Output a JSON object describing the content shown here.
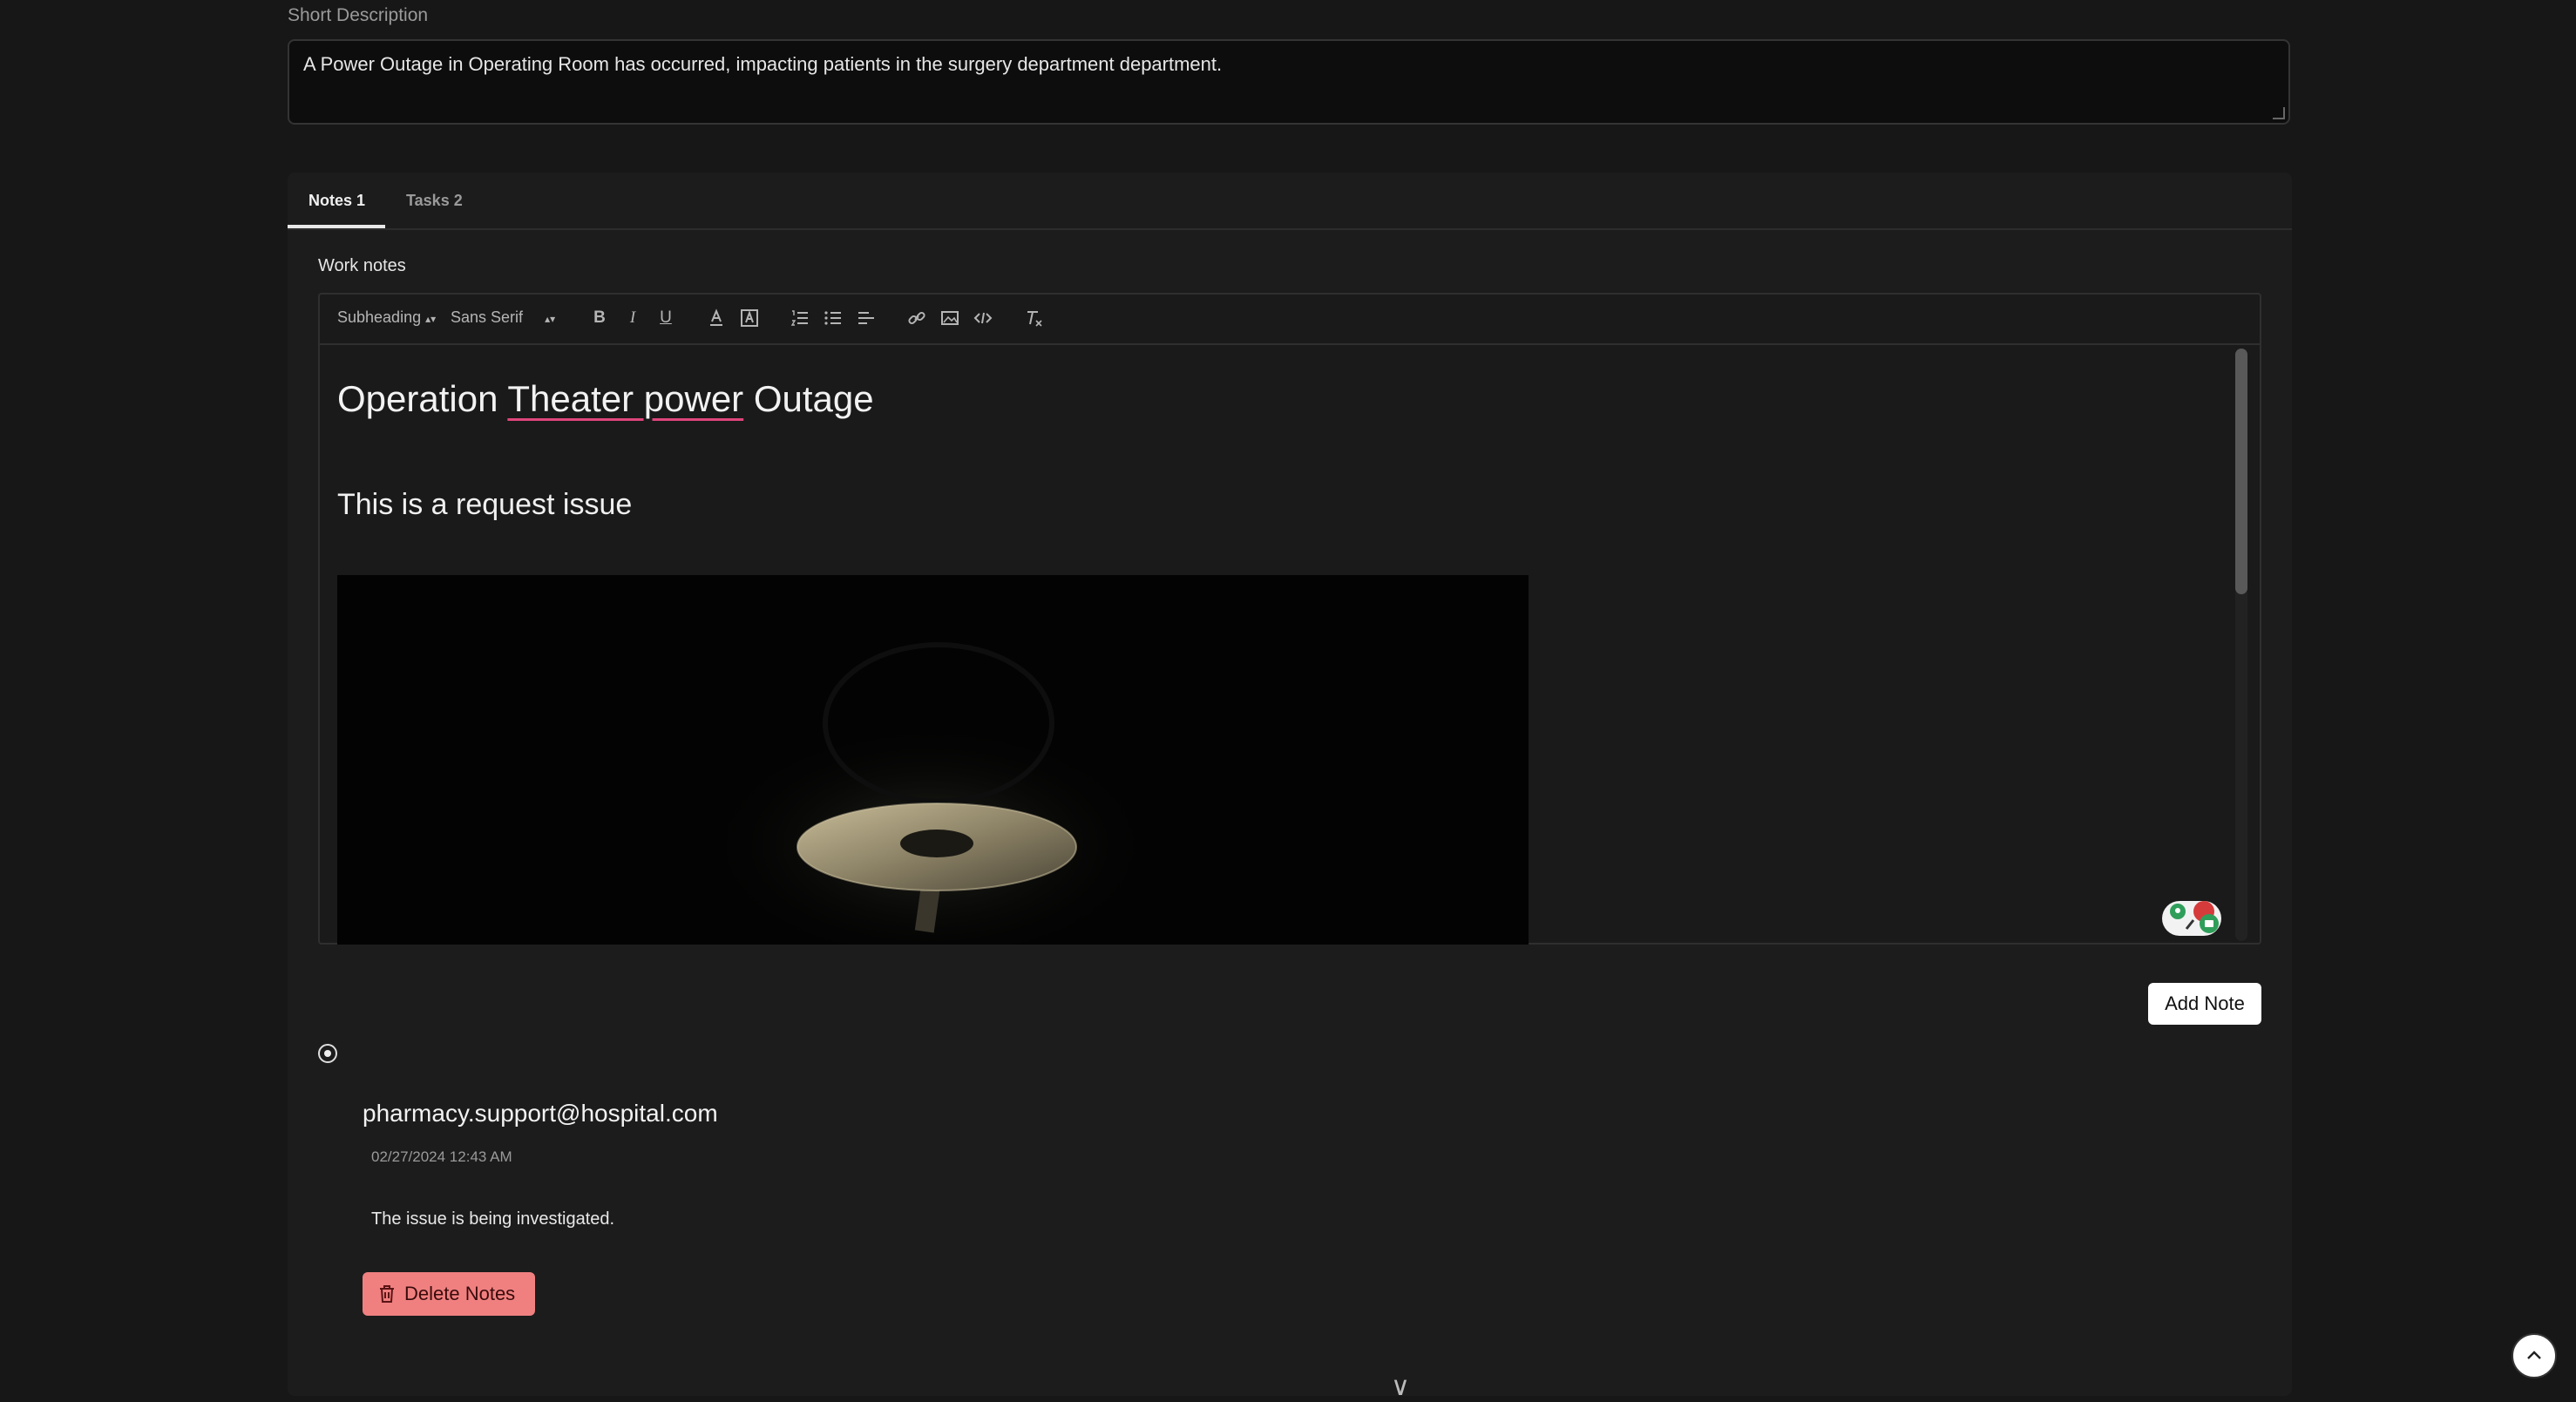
{
  "short_description": {
    "label": "Short Description",
    "value": "A Power Outage in Operating Room has occurred, impacting patients in the surgery department department."
  },
  "tabs": [
    {
      "label": "Notes 1",
      "active": true
    },
    {
      "label": "Tasks 2",
      "active": false
    }
  ],
  "work_notes": {
    "label": "Work notes",
    "toolbar": {
      "heading_select": "Subheading",
      "font_select": "Sans Serif",
      "icons": [
        "bold-icon",
        "italic-icon",
        "underline-icon",
        "text-color-icon",
        "background-color-icon",
        "ordered-list-icon",
        "bullet-list-icon",
        "align-icon",
        "link-icon",
        "image-icon",
        "code-icon",
        "clear-format-icon"
      ]
    },
    "content": {
      "heading_pre": "Operation ",
      "heading_spell": "Theater power",
      "heading_post": " Outage",
      "paragraph": "This is a request issue"
    }
  },
  "add_note_label": "Add Note",
  "note": {
    "author": "pharmacy.support@hospital.com",
    "timestamp": "02/27/2024 12:43 AM",
    "body": "The issue is being investigated.",
    "delete_label": "Delete Notes"
  },
  "colors": {
    "background": "#171717",
    "delete": "#f08080",
    "spell_underline": "#e0457b"
  }
}
